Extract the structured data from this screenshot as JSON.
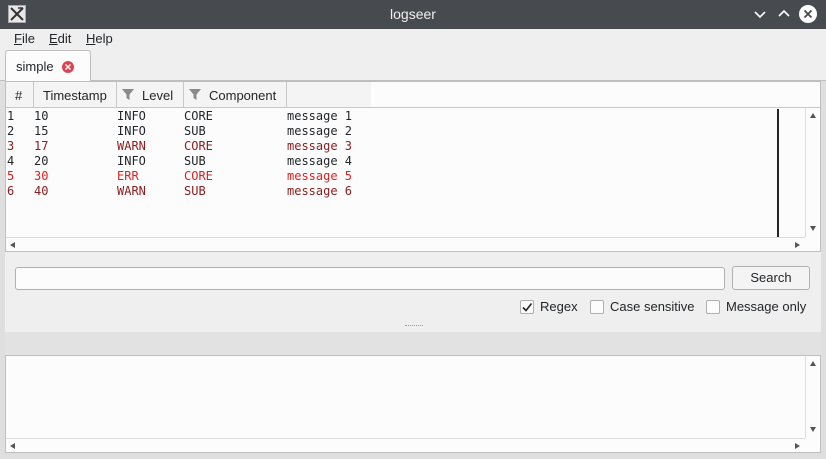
{
  "window": {
    "title": "logseer"
  },
  "menu": [
    "File",
    "Edit",
    "Help"
  ],
  "tab": {
    "label": "simple"
  },
  "table": {
    "headers": [
      "#",
      "Timestamp",
      "Level",
      "Component"
    ],
    "rows": [
      {
        "num": "1",
        "ts": "10",
        "level": "INFO",
        "component": "CORE",
        "message": "message 1",
        "color": "#232629"
      },
      {
        "num": "2",
        "ts": "15",
        "level": "INFO",
        "component": "SUB",
        "message": "message 2",
        "color": "#232629"
      },
      {
        "num": "3",
        "ts": "17",
        "level": "WARN",
        "component": "CORE",
        "message": "message 3",
        "color": "#8a1d1d"
      },
      {
        "num": "4",
        "ts": "20",
        "level": "INFO",
        "component": "SUB",
        "message": "message 4",
        "color": "#232629"
      },
      {
        "num": "5",
        "ts": "30",
        "level": "ERR",
        "component": "CORE",
        "message": "message 5",
        "color": "#e02020"
      },
      {
        "num": "6",
        "ts": "40",
        "level": "WARN",
        "component": "SUB",
        "message": "message 6",
        "color": "#8a1d1d"
      }
    ]
  },
  "search": {
    "value": "",
    "button_label": "Search",
    "options": [
      {
        "label": "Regex",
        "checked": true
      },
      {
        "label": "Case sensitive",
        "checked": false
      },
      {
        "label": "Message only",
        "checked": false
      }
    ]
  },
  "icons": {
    "app": "app-logo-icon",
    "minimize": "chevron-down-icon",
    "maximize": "chevron-up-icon",
    "close": "close-icon",
    "tab_close": "tab-close-icon",
    "filter": "filter-icon",
    "check": "checkmark-icon"
  }
}
